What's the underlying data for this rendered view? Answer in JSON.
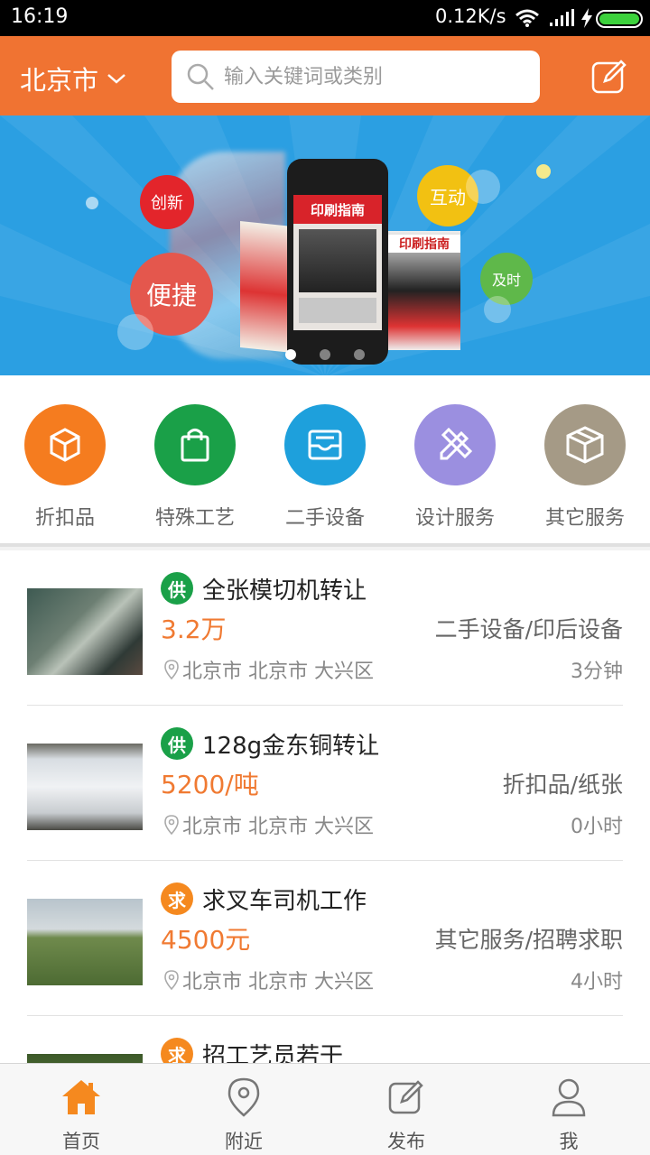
{
  "status_bar": {
    "time": "16:19",
    "net_speed": "0.12K/s"
  },
  "header": {
    "city": "北京市",
    "search_placeholder": "输入关键词或类别"
  },
  "banner": {
    "tags": [
      "创新",
      "便捷",
      "互动",
      "及时"
    ],
    "magazine_title": "印刷指南",
    "pager_count": 3,
    "pager_active": 0
  },
  "categories": [
    {
      "label": "折扣品",
      "icon": "cube-icon",
      "color": "#f57c1f"
    },
    {
      "label": "特殊工艺",
      "icon": "bag-icon",
      "color": "#1aa048"
    },
    {
      "label": "二手设备",
      "icon": "inbox-icon",
      "color": "#1ea0dc"
    },
    {
      "label": "设计服务",
      "icon": "pencil-ruler-icon",
      "color": "#9b8fe0"
    },
    {
      "label": "其它服务",
      "icon": "box-icon",
      "color": "#a59a86"
    }
  ],
  "listings": [
    {
      "badge": "供",
      "badge_color": "#1aa048",
      "title": "全张模切机转让",
      "price": "3.2万",
      "category": "二手设备/印后设备",
      "location": "北京市 北京市 大兴区",
      "time": "3分钟"
    },
    {
      "badge": "供",
      "badge_color": "#1aa048",
      "title": "128g金东铜转让",
      "price": "5200/吨",
      "category": "折扣品/纸张",
      "location": "北京市 北京市 大兴区",
      "time": "0小时"
    },
    {
      "badge": "求",
      "badge_color": "#f5891f",
      "title": "求叉车司机工作",
      "price": "4500元",
      "category": "其它服务/招聘求职",
      "location": "北京市 北京市 大兴区",
      "time": "4小时"
    },
    {
      "badge": "求",
      "badge_color": "#f5891f",
      "title": "招工艺员若干",
      "price": "",
      "category": "",
      "location": "",
      "time": ""
    }
  ],
  "bottom_nav": [
    {
      "label": "首页",
      "icon": "home-icon",
      "active": true
    },
    {
      "label": "附近",
      "icon": "location-pin-icon",
      "active": false
    },
    {
      "label": "发布",
      "icon": "edit-icon",
      "active": false
    },
    {
      "label": "我",
      "icon": "user-icon",
      "active": false
    }
  ]
}
